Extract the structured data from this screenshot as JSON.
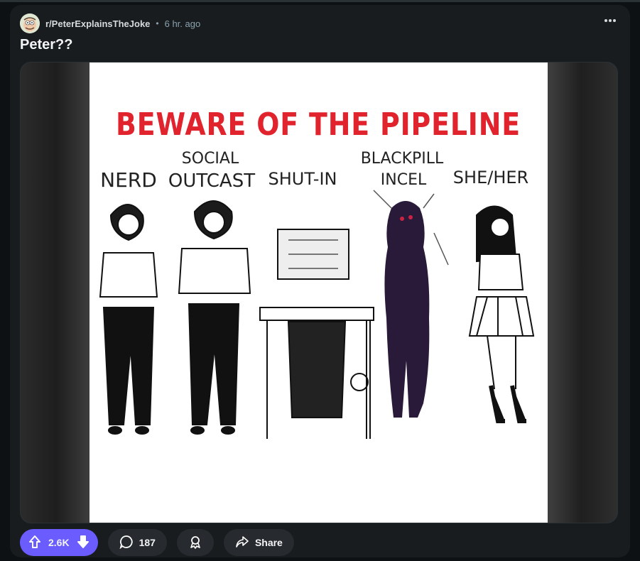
{
  "post": {
    "subreddit": "r/PeterExplainsTheJoke",
    "separator": "•",
    "time": "6 hr. ago",
    "title": "Peter??"
  },
  "comic": {
    "headline": "BEWARE OF THE PIPELINE",
    "labels": [
      [
        "NERD"
      ],
      [
        "SOCIAL",
        "OUTCAST"
      ],
      [
        "SHUT-IN"
      ],
      [
        "BLACKPILL",
        "INCEL"
      ],
      [
        "SHE/HER"
      ]
    ]
  },
  "actions": {
    "votes": "2.6K",
    "comments": "187",
    "share": "Share"
  },
  "colors": {
    "vote_active": "#6a5cff",
    "comic_title": "#e0232c"
  },
  "icons": [
    "more-options-icon",
    "upvote-icon",
    "downvote-icon",
    "comment-icon",
    "award-icon",
    "share-icon",
    "subreddit-avatar-icon"
  ]
}
